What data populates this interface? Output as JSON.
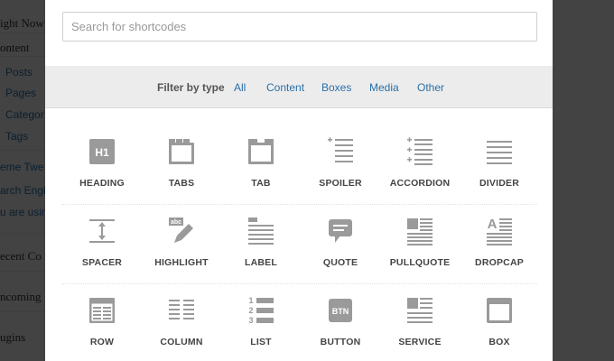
{
  "background": {
    "items": [
      {
        "text": "ight Now",
        "kind": "title"
      },
      {
        "text": "ontent",
        "kind": "title"
      },
      {
        "text": "Posts",
        "kind": "sub"
      },
      {
        "text": "Pages",
        "kind": "sub"
      },
      {
        "text": "Categor",
        "kind": "sub"
      },
      {
        "text": "Tags",
        "kind": "sub"
      },
      {
        "text": "eme Twe",
        "kind": "link"
      },
      {
        "text": "arch Engi",
        "kind": "link"
      },
      {
        "text": "u are usin",
        "kind": "link"
      },
      {
        "text": "ecent Co",
        "kind": "title"
      },
      {
        "text": "ncoming",
        "kind": "title"
      },
      {
        "text": "ugins",
        "kind": "title"
      }
    ]
  },
  "search": {
    "placeholder": "Search for shortcodes",
    "value": ""
  },
  "filter": {
    "label": "Filter by type",
    "options": [
      "All",
      "Content",
      "Boxes",
      "Media",
      "Other"
    ]
  },
  "shortcodes": [
    [
      {
        "label": "HEADING",
        "icon": "heading-icon"
      },
      {
        "label": "TABS",
        "icon": "tabs-icon"
      },
      {
        "label": "TAB",
        "icon": "tab-icon"
      },
      {
        "label": "SPOILER",
        "icon": "spoiler-icon"
      },
      {
        "label": "ACCORDION",
        "icon": "accordion-icon"
      },
      {
        "label": "DIVIDER",
        "icon": "divider-icon"
      }
    ],
    [
      {
        "label": "SPACER",
        "icon": "spacer-icon"
      },
      {
        "label": "HIGHLIGHT",
        "icon": "highlight-icon"
      },
      {
        "label": "LABEL",
        "icon": "label-icon"
      },
      {
        "label": "QUOTE",
        "icon": "quote-icon"
      },
      {
        "label": "PULLQUOTE",
        "icon": "pullquote-icon"
      },
      {
        "label": "DROPCAP",
        "icon": "dropcap-icon"
      }
    ],
    [
      {
        "label": "ROW",
        "icon": "row-icon"
      },
      {
        "label": "COLUMN",
        "icon": "column-icon"
      },
      {
        "label": "LIST",
        "icon": "list-icon"
      },
      {
        "label": "BUTTON",
        "icon": "button-icon"
      },
      {
        "label": "SERVICE",
        "icon": "service-icon"
      },
      {
        "label": "BOX",
        "icon": "box-icon"
      }
    ]
  ],
  "icon_glyphs": {
    "heading": "H1",
    "button": "BTN",
    "highlight": "abc",
    "dropcap": "A",
    "list": [
      "1",
      "2",
      "3"
    ]
  },
  "colors": {
    "icon": "#9a9a9a",
    "link": "#2a6fa8",
    "label": "#444444"
  }
}
